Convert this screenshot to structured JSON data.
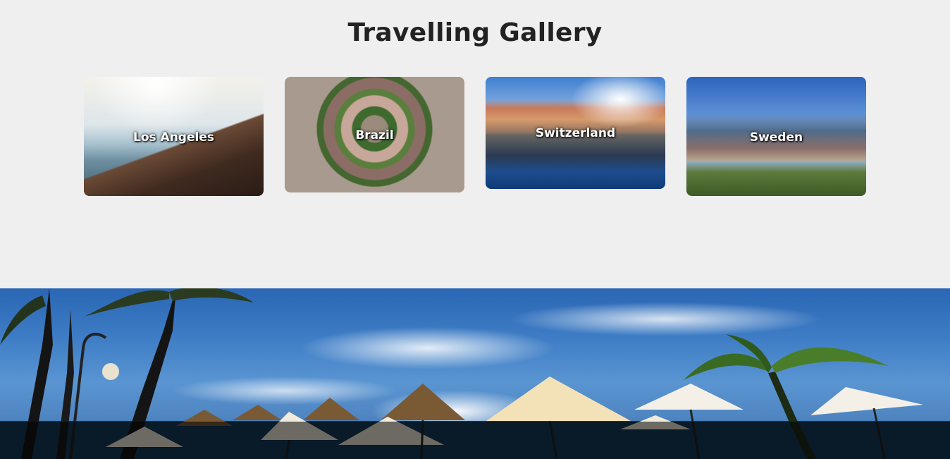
{
  "header": {
    "title": "Travelling Gallery"
  },
  "gallery": {
    "cards": [
      {
        "label": "Los Angeles"
      },
      {
        "label": "Brazil"
      },
      {
        "label": "Switzerland"
      },
      {
        "label": "Sweden"
      }
    ]
  }
}
